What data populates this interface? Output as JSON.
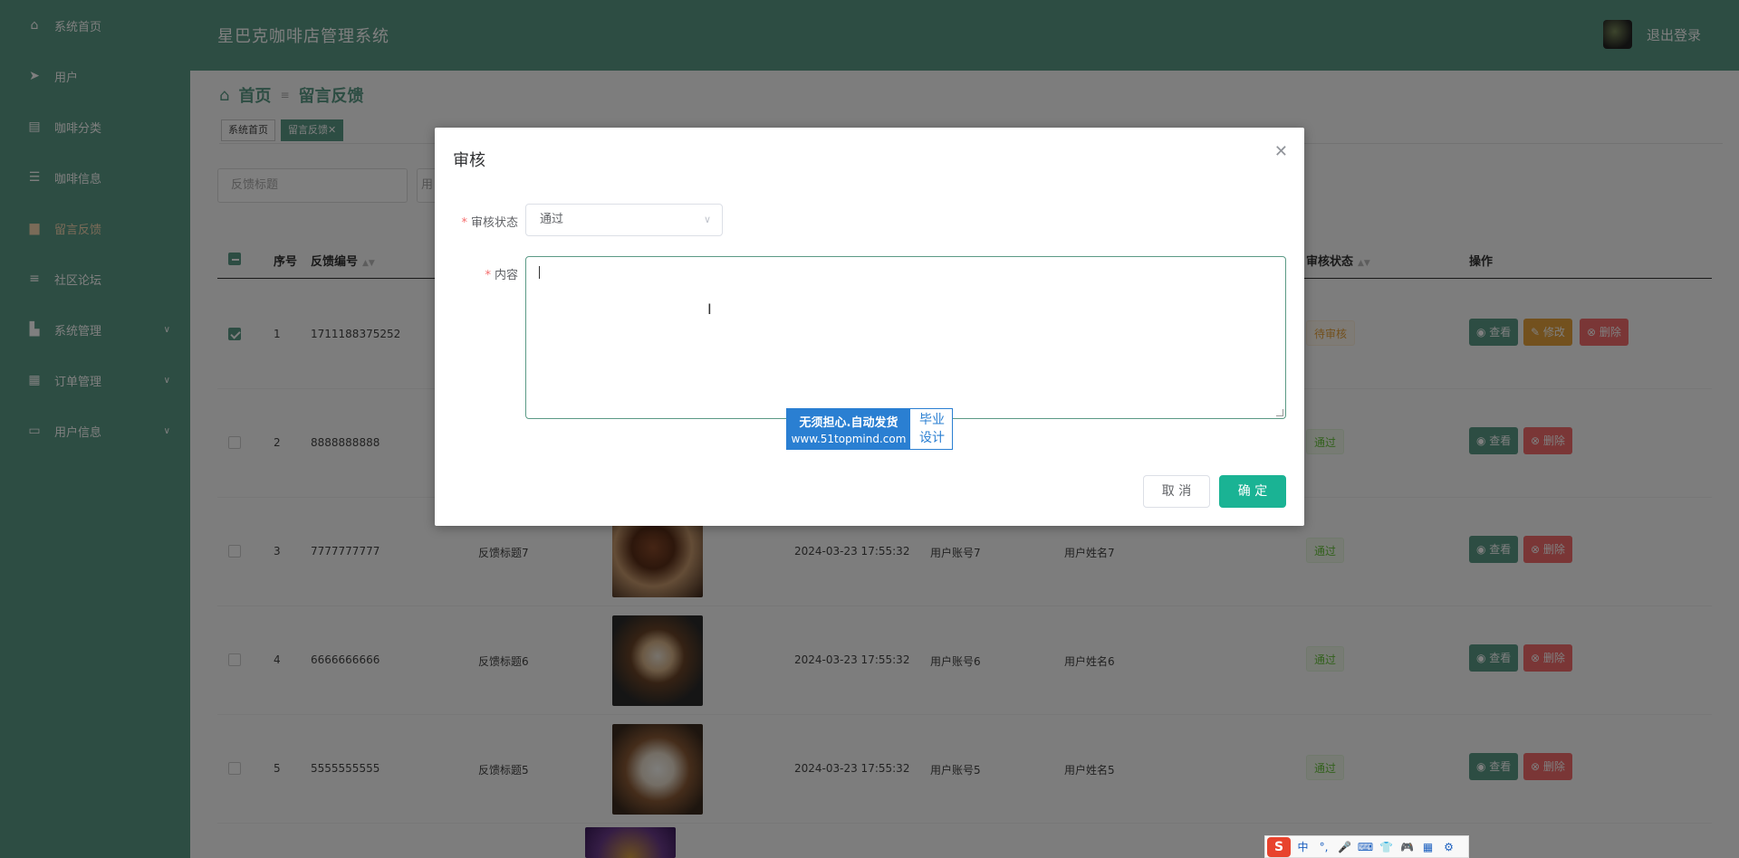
{
  "sidebar": {
    "items": [
      {
        "label": "系统首页",
        "icon": "home-icon"
      },
      {
        "label": "用户",
        "icon": "send-icon"
      },
      {
        "label": "咖啡分类",
        "icon": "chart-icon"
      },
      {
        "label": "咖啡信息",
        "icon": "sliders-icon"
      },
      {
        "label": "留言反馈",
        "icon": "message-icon"
      },
      {
        "label": "社区论坛",
        "icon": "list-icon"
      },
      {
        "label": "系统管理",
        "icon": "bar-icon"
      },
      {
        "label": "订单管理",
        "icon": "grid-icon"
      },
      {
        "label": "用户信息",
        "icon": "window-icon"
      }
    ]
  },
  "header": {
    "title": "星巴克咖啡店管理系统",
    "logout": "退出登录"
  },
  "breadcrumb": {
    "home": "首页",
    "current": "留言反馈"
  },
  "tabs": [
    "系统首页",
    "留言反馈✕"
  ],
  "search": {
    "title_placeholder": "反馈标题",
    "second_placeholder": "用"
  },
  "table": {
    "headers": {
      "index": "序号",
      "code": "反馈编号",
      "status": "审核状态",
      "actions": "操作"
    },
    "rows": [
      {
        "index": "1",
        "code": "1711188375252",
        "title": "",
        "time": "",
        "account": "",
        "name": "",
        "status": "待审核"
      },
      {
        "index": "2",
        "code": "8888888888",
        "title": "",
        "time": "",
        "account": "",
        "name": "",
        "status": "通过"
      },
      {
        "index": "3",
        "code": "7777777777",
        "title": "反馈标题7",
        "time": "2024-03-23 17:55:32",
        "account": "用户账号7",
        "name": "用户姓名7",
        "status": "通过"
      },
      {
        "index": "4",
        "code": "6666666666",
        "title": "反馈标题6",
        "time": "2024-03-23 17:55:32",
        "account": "用户账号6",
        "name": "用户姓名6",
        "status": "通过"
      },
      {
        "index": "5",
        "code": "5555555555",
        "title": "反馈标题5",
        "time": "2024-03-23 17:55:32",
        "account": "用户账号5",
        "name": "用户姓名5",
        "status": "通过"
      }
    ],
    "buttons": {
      "view": "查看",
      "edit": "修改",
      "delete": "删除"
    }
  },
  "dialog": {
    "title": "审核",
    "status_label": "审核状态",
    "status_value": "通过",
    "content_label": "内容",
    "cancel": "取 消",
    "confirm": "确 定"
  },
  "watermark": {
    "line1": "无须担心.自动发货",
    "line2": "www.51topmind.com",
    "right1": "毕业",
    "right2": "设计"
  },
  "ime": {
    "logo": "S",
    "mode": "中",
    "punct": "°,",
    "mic": "🎤",
    "keyboard": "⌨",
    "shirt": "👕",
    "game": "🎮",
    "apps": "▦",
    "settings": "⚙"
  },
  "colors": {
    "primary": "#5b9a86",
    "confirm": "#1ab394",
    "edit": "#e6a23c",
    "delete": "#f56c6c",
    "pass": "#67c23a"
  }
}
